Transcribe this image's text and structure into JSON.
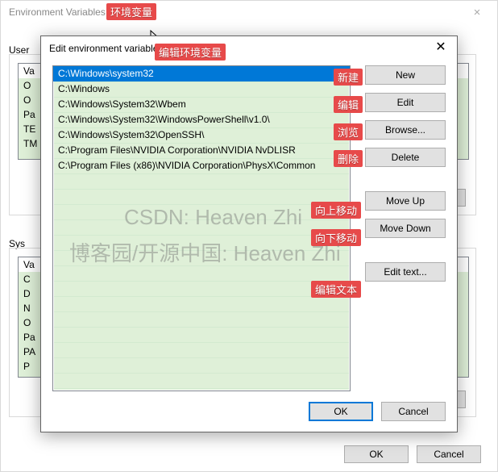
{
  "outer": {
    "title": "Environment Variables",
    "user_label": "User",
    "system_label": "Sys",
    "list_header": "Va",
    "user_rows_left": [
      "O",
      "O",
      "Pa",
      "TE",
      "TM"
    ],
    "sys_rows_left": [
      "Va",
      "C",
      "D",
      "N",
      "O",
      "Pa",
      "PA",
      "P"
    ],
    "ok": "OK",
    "cancel": "Cancel"
  },
  "annotations": {
    "title": "环境变量",
    "subtitle": "编辑环境变量",
    "new": "新建",
    "edit": "编辑",
    "browse": "浏览",
    "delete": "删除",
    "moveup": "向上移动",
    "movedown": "向下移动",
    "edittext": "编辑文本"
  },
  "modal": {
    "title": "Edit environment variable",
    "items": [
      "C:\\Windows\\system32",
      "C:\\Windows",
      "C:\\Windows\\System32\\Wbem",
      "C:\\Windows\\System32\\WindowsPowerShell\\v1.0\\",
      "C:\\Windows\\System32\\OpenSSH\\",
      "C:\\Program Files\\NVIDIA Corporation\\NVIDIA NvDLISR",
      "C:\\Program Files (x86)\\NVIDIA Corporation\\PhysX\\Common"
    ],
    "selected_index": 0,
    "buttons": {
      "new": "New",
      "edit": "Edit",
      "browse": "Browse...",
      "delete": "Delete",
      "move_up": "Move Up",
      "move_down": "Move Down",
      "edit_text": "Edit text..."
    },
    "ok": "OK",
    "cancel": "Cancel"
  },
  "watermarks": {
    "w1": "CSDN: Heaven Zhi",
    "w2": "博客园/开源中国: Heaven Zhi"
  }
}
